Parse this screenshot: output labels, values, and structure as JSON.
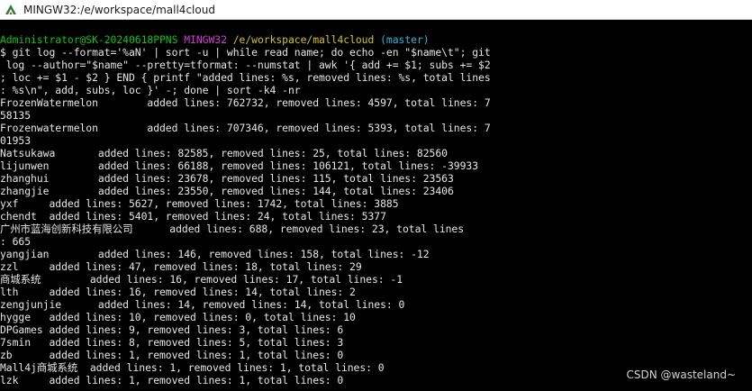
{
  "window": {
    "title": "MINGW32:/e/workspace/mall4cloud",
    "icon": "mingw-terminal-icon"
  },
  "prompt": {
    "user_host": "Administrator@SK-20240618PPNS",
    "system": "MINGW32",
    "path": "/e/workspace/mall4cloud",
    "branch": "(master)"
  },
  "output_lines": [
    "$ git log --format='%aN' | sort -u | while read name; do echo -en \"$name\\t\"; git",
    " log --author=\"$name\" --pretty=tformat: --numstat | awk '{ add += $1; subs += $2",
    "; loc += $1 - $2 } END { printf \"added lines: %s, removed lines: %s, total lines",
    ": %s\\n\", add, subs, loc }' -; done | sort -k4 -nr",
    "FrozenWatermelon        added lines: 762732, removed lines: 4597, total lines: 7",
    "58135",
    "Frozenwatermelon        added lines: 707346, removed lines: 5393, total lines: 7",
    "01953",
    "Natsukawa       added lines: 82585, removed lines: 25, total lines: 82560",
    "lijunwen        added lines: 66188, removed lines: 106121, total lines: -39933",
    "zhanghui        added lines: 23678, removed lines: 115, total lines: 23563",
    "zhangjie        added lines: 23550, removed lines: 144, total lines: 23406",
    "yxf     added lines: 5627, removed lines: 1742, total lines: 3885",
    "chendt  added lines: 5401, removed lines: 24, total lines: 5377",
    "广州市蓝海创新科技有限公司      added lines: 688, removed lines: 23, total lines",
    ": 665",
    "yangjian        added lines: 146, removed lines: 158, total lines: -12",
    "zzl     added lines: 47, removed lines: 18, total lines: 29",
    "商城系统        added lines: 16, removed lines: 17, total lines: -1",
    "lth     added lines: 16, removed lines: 14, total lines: 2",
    "zengjunjie      added lines: 14, removed lines: 14, total lines: 0",
    "hygge   added lines: 10, removed lines: 0, total lines: 10",
    "DPGames added lines: 9, removed lines: 3, total lines: 6",
    "7smin   added lines: 8, removed lines: 5, total lines: 3",
    "zb      added lines: 1, removed lines: 1, total lines: 0",
    "Mall4j商城系统  added lines: 1, removed lines: 1, total lines: 0",
    "lzk     added lines: 1, removed lines: 1, total lines: 0"
  ],
  "watermark": "CSDN @wasteland~",
  "colors": {
    "background": "#000000",
    "text": "#e6e6e6",
    "user_host": "#12c312",
    "system": "#d33cd3",
    "path": "#d0c41e",
    "branch": "#29b8db"
  }
}
